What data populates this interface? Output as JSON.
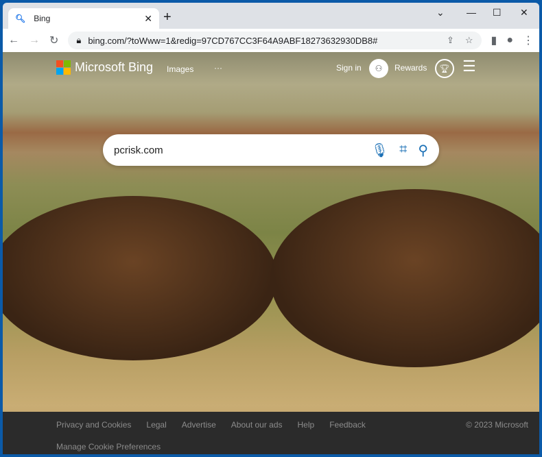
{
  "browser": {
    "tab_title": "Bing",
    "url": "bing.com/?toWww=1&redig=97CD767CC3F64A9ABF18273632930DB8#"
  },
  "header": {
    "brand": "Microsoft Bing",
    "images": "Images",
    "more": "···",
    "sign_in": "Sign in",
    "rewards": "Rewards"
  },
  "search": {
    "value": "pcrisk.com"
  },
  "footer": {
    "links": [
      "Privacy and Cookies",
      "Legal",
      "Advertise",
      "About our ads",
      "Help",
      "Feedback"
    ],
    "copyright": "© 2023 Microsoft",
    "manage_cookies": "Manage Cookie Preferences"
  },
  "colors": {
    "accent": "#1a6fb5",
    "footer_bg": "#2b2b2b"
  }
}
